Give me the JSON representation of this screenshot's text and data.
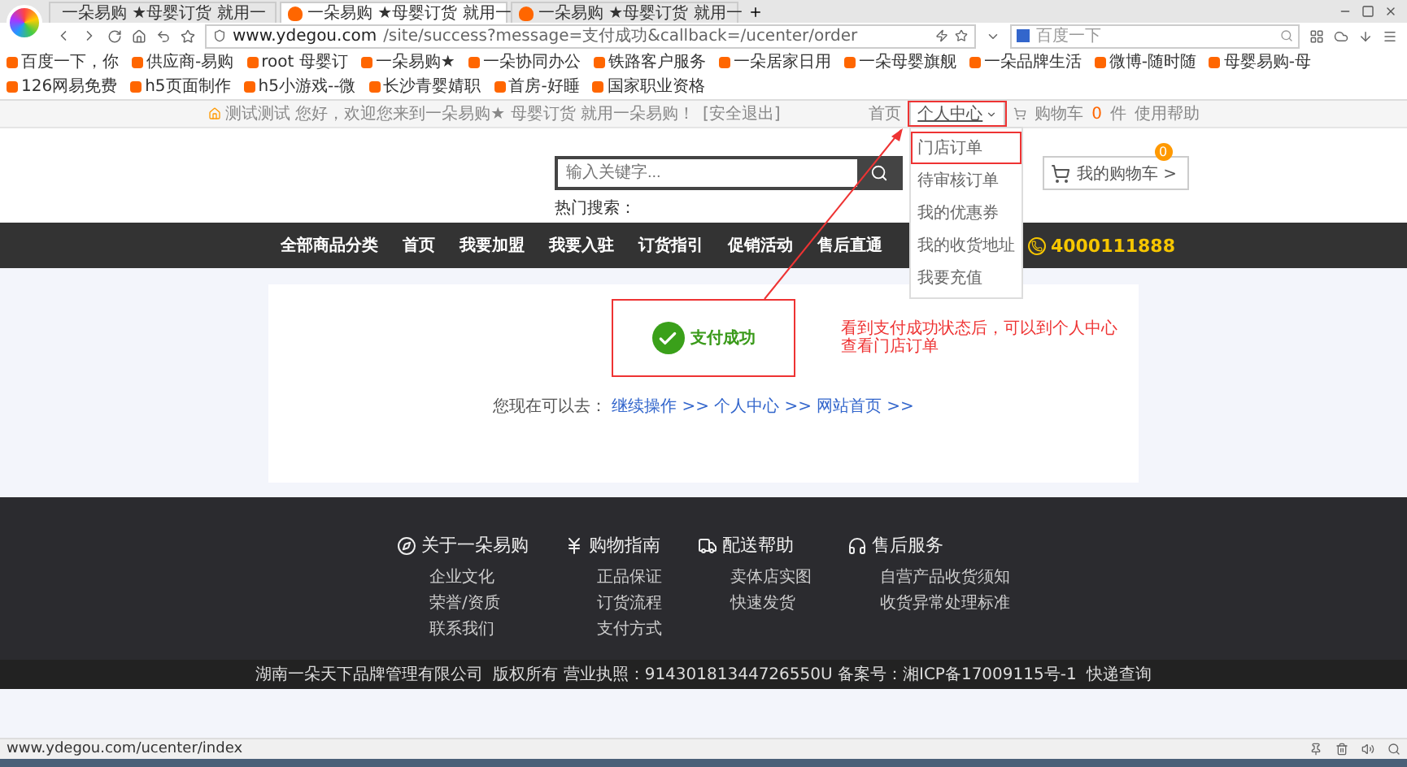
{
  "browser": {
    "tabs": [
      {
        "title": "一朵易购 ★母婴订货 就用一",
        "selected": false,
        "kind": "page"
      },
      {
        "title": "一朵易购 ★母婴订货 就用一",
        "selected": true,
        "kind": "site"
      },
      {
        "title": "一朵易购 ★母婴订货 就用一",
        "selected": false,
        "kind": "site"
      }
    ],
    "url_host": "www.ydegou.com",
    "url_path": "/site/success?message=支付成功&callback=/ucenter/order",
    "search_placeholder": "百度一下",
    "bookmarks": [
      {
        "label": "百度一下，你"
      },
      {
        "label": "供应商-易购"
      },
      {
        "label": "root 母婴订"
      },
      {
        "label": "一朵易购★"
      },
      {
        "label": "一朵协同办公"
      },
      {
        "label": "铁路客户服务"
      },
      {
        "label": "一朵居家日用"
      },
      {
        "label": "一朵母婴旗舰"
      },
      {
        "label": "一朵品牌生活"
      },
      {
        "label": "微博-随时随"
      },
      {
        "label": "母婴易购-母"
      },
      {
        "label": "126网易免费"
      },
      {
        "label": "h5页面制作"
      },
      {
        "label": "h5小游戏--微"
      },
      {
        "label": "长沙青婴婧职"
      },
      {
        "label": "首房-好睡"
      },
      {
        "label": "国家职业资格"
      }
    ],
    "status_url": "www.ydegou.com/ucenter/index"
  },
  "topbar": {
    "greeting": "测试测试 您好，欢迎您来到一朵易购★ 母婴订货 就用一朵易购！",
    "logout": "[安全退出]",
    "home": "首页",
    "user_menu": {
      "label": "个人中心",
      "expanded": true,
      "highlighted": true,
      "items": [
        {
          "label": "门店订单",
          "highlighted": true
        },
        {
          "label": "待审核订单",
          "highlighted": false
        },
        {
          "label": "我的优惠券",
          "highlighted": false
        },
        {
          "label": "我的收货地址",
          "highlighted": false
        },
        {
          "label": "我要充值",
          "highlighted": false
        }
      ]
    },
    "cart_label": "购物车",
    "cart_count": "0",
    "cart_unit": "件",
    "help": "使用帮助"
  },
  "header": {
    "search_placeholder": "输入关键字...",
    "hot_search": "热门搜索：",
    "cart_button": "我的购物车 >",
    "cart_badge": "0"
  },
  "nav": {
    "category": "全部商品分类",
    "items": [
      "首页",
      "我要加盟",
      "我要入驻",
      "订货指引",
      "促销活动",
      "售后直通"
    ],
    "phone": "4000111888"
  },
  "result": {
    "message": "支付成功",
    "highlighted": true,
    "prompt": "您现在可以去：",
    "links": [
      "继续操作 >>",
      "个人中心 >>",
      "网站首页 >>"
    ],
    "annotation": "看到支付成功状态后，可以到个人中心查看门店订单"
  },
  "footer": {
    "columns": [
      {
        "title": "关于一朵易购",
        "kind": "compass",
        "links": [
          "企业文化",
          "荣誉/资质",
          "联系我们"
        ]
      },
      {
        "title": "购物指南",
        "kind": "yen",
        "links": [
          "正品保证",
          "订货流程",
          "支付方式"
        ]
      },
      {
        "title": "配送帮助",
        "kind": "truck",
        "links": [
          "卖体店实图",
          "快速发货"
        ]
      },
      {
        "title": "售后服务",
        "kind": "service",
        "links": [
          "自营产品收货须知",
          "收货异常处理标准"
        ]
      }
    ],
    "copyright": "湖南一朵天下品牌管理有限公司  版权所有 营业执照：91430181344726550U 备案号：湘ICP备17009115号-1  快递查询"
  }
}
